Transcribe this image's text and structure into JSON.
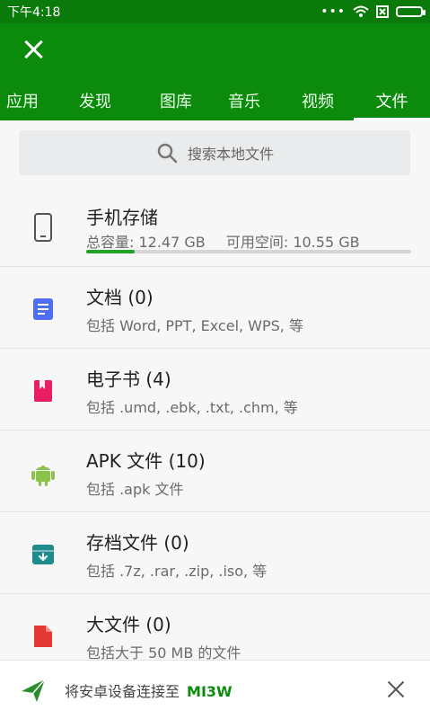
{
  "status": {
    "time": "下午4:18",
    "dots": "•••"
  },
  "tabs": [
    {
      "label": "应用"
    },
    {
      "label": "发现"
    },
    {
      "label": "图库"
    },
    {
      "label": "音乐"
    },
    {
      "label": "视频"
    },
    {
      "label": "文件"
    }
  ],
  "search": {
    "placeholder": "搜索本地文件"
  },
  "storage": {
    "title": "手机存储",
    "total": "总容量: 12.47 GB",
    "available": "可用空间: 10.55 GB",
    "used_fraction": 0.15
  },
  "categories": [
    {
      "title": "文档 (0)",
      "sub": "包括 Word, PPT, Excel, WPS, 等",
      "icon": "document-icon",
      "color": "#4f6ef7"
    },
    {
      "title": "电子书 (4)",
      "sub": "包括 .umd, .ebk, .txt, .chm, 等",
      "icon": "ebook-icon",
      "color": "#e91e63"
    },
    {
      "title": "APK 文件 (10)",
      "sub": "包括 .apk 文件",
      "icon": "android-icon",
      "color": "#8bc34a"
    },
    {
      "title": "存档文件 (0)",
      "sub": "包括 .7z, .rar, .zip, .iso, 等",
      "icon": "archive-icon",
      "color": "#1e8c8c"
    },
    {
      "title": "大文件 (0)",
      "sub": "包括大于 50 MB 的文件",
      "icon": "large-file-icon",
      "color": "#e53935"
    }
  ],
  "bottom": {
    "text": "将安卓设备连接至",
    "highlight": "MI3W"
  },
  "colors": {
    "brand": "#0b8a0b",
    "status_bar": "#0a7a0a"
  }
}
